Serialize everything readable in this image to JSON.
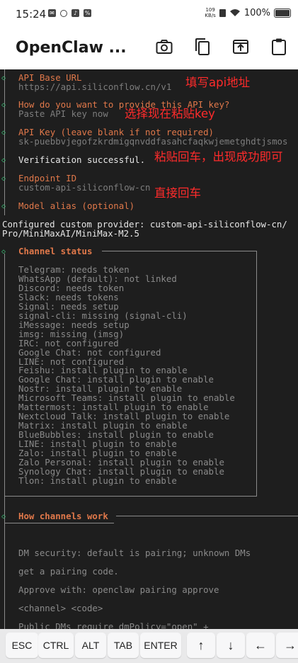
{
  "status_bar": {
    "time": "15:24",
    "net_speed_top": "109",
    "net_speed_bottom": "KB/s",
    "battery": "100%"
  },
  "app_bar": {
    "title": "OpenClaw ...",
    "actions": [
      "camera-icon",
      "copy-icon",
      "open-external-icon",
      "clipboard-icon"
    ]
  },
  "terminal": {
    "api_base_url_label": "API Base URL",
    "api_base_url_value": "https://api.siliconflow.cn/v1",
    "provide_key_label": "How do you want to provide this API key?",
    "provide_key_value": "Paste API key now",
    "api_key_label": "API Key (leave blank if not required)",
    "api_key_value": "sk-puebbvjegofzkrdmigqnvddfasahcfaqkwjemetghdtjsmos",
    "verification": "Verification successful.",
    "endpoint_label": "Endpoint ID",
    "endpoint_value": "custom-api-siliconflow-cn",
    "model_alias_label": "Model alias (optional)",
    "configured_line1": "Configured custom provider: custom-api-siliconflow-cn/",
    "configured_line2": "Pro/MiniMaxAI/MiniMax-M2.5",
    "channel_status_title": "Channel status",
    "channels": [
      "Telegram: needs token",
      "WhatsApp (default): not linked",
      "Discord: needs token",
      "Slack: needs tokens",
      "Signal: needs setup",
      "signal-cli: missing (signal-cli)",
      "iMessage: needs setup",
      "imsg: missing (imsg)",
      "IRC: not configured",
      "Google Chat: not configured",
      "LINE: not configured",
      "Feishu: install plugin to enable",
      "Google Chat: install plugin to enable",
      "Nostr: install plugin to enable",
      "Microsoft Teams: install plugin to enable",
      "Mattermost: install plugin to enable",
      "Nextcloud Talk: install plugin to enable",
      "Matrix: install plugin to enable",
      "BlueBubbles: install plugin to enable",
      "LINE: install plugin to enable",
      "Zalo: install plugin to enable",
      "Zalo Personal: install plugin to enable",
      "Synology Chat: install plugin to enable",
      "Tlon: install plugin to enable"
    ],
    "how_channels_title": "How channels work",
    "how_lines": [
      "DM security: default is pairing; unknown DMs",
      "get a pairing code.",
      "Approve with: openclaw pairing approve",
      "<channel> <code>",
      "Public DMs require dmPolicy=\"open\" +"
    ]
  },
  "annotations": {
    "note_api_url": "填写api地址",
    "note_paste_key": "选择现在粘贴key",
    "note_enter_success": "粘贴回车，出现成功即可",
    "note_enter": "直接回车"
  },
  "keys": [
    "ESC",
    "CTRL",
    "ALT",
    "TAB",
    "ENTER",
    "↑",
    "↓",
    "←",
    "→"
  ],
  "colors": {
    "terminal_bg": "#1e1e1e",
    "label_orange": "#e0784a",
    "diamond_green": "#3cb371",
    "note_red": "#ff2b2b"
  }
}
